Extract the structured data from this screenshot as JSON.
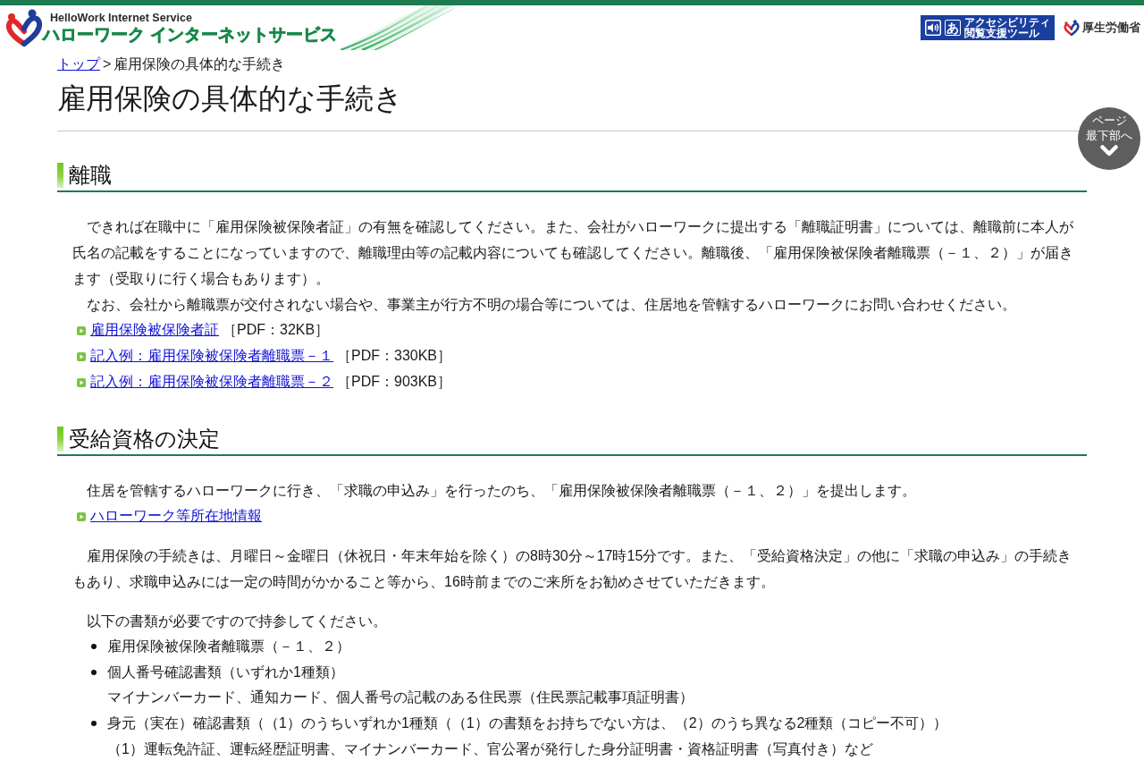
{
  "header": {
    "logo": {
      "tagline": "HelloWork Internet Service",
      "title": "ハローワーク インターネットサービス"
    },
    "accessibility_tool": {
      "glyph": "あ",
      "label_lines": [
        "アクセシビリティ",
        "閲覧支援ツール"
      ]
    },
    "ministry_logo": {
      "name": "厚生労働省"
    }
  },
  "breadcrumb": {
    "separator": ">",
    "items": [
      {
        "label": "トップ",
        "kind": "link"
      },
      {
        "label": "雇用保険の具体的な手続き",
        "kind": "current"
      }
    ]
  },
  "page_title": "雇用保険の具体的な手続き",
  "scroll_button": {
    "lines": [
      "ページ",
      "最下部へ"
    ]
  },
  "sections": [
    {
      "heading": "離職",
      "groups": [
        {
          "blocks": [
            {
              "kind": "paragraph",
              "text": "できれば在職中に「雇用保険被保険者証」の有無を確認してください。また、会社がハローワークに提出する「離職証明書」については、離職前に本人が氏名の記載をすることになっていますので、離職理由等の記載内容についても確認してください。離職後、「雇用保険被保険者離職票（－１、２）」が届きます（受取りに行く場合もあります）。"
            },
            {
              "kind": "paragraph",
              "text": "なお、会社から離職票が交付されない場合や、事業主が行方不明の場合等については、住居地を管轄するハローワークにお問い合わせください。"
            },
            {
              "kind": "links",
              "items": [
                {
                  "label": "雇用保険被保険者証",
                  "size": "［PDF：32KB］"
                },
                {
                  "label": "記入例：雇用保険被保険者離職票－１",
                  "size": "［PDF：330KB］"
                },
                {
                  "label": "記入例：雇用保険被保険者離職票－２",
                  "size": "［PDF：903KB］"
                }
              ]
            }
          ]
        }
      ]
    },
    {
      "heading": "受給資格の決定",
      "groups": [
        {
          "blocks": [
            {
              "kind": "paragraph",
              "text": "住居を管轄するハローワークに行き、「求職の申込み」を行ったのち、「雇用保険被保険者離職票（－１、２）」を提出します。"
            },
            {
              "kind": "links",
              "items": [
                {
                  "label": "ハローワーク等所在地情報"
                }
              ]
            }
          ]
        },
        {
          "blocks": [
            {
              "kind": "paragraph",
              "text": "雇用保険の手続きは、月曜日～金曜日（休祝日・年末年始を除く）の8時30分～17時15分です。また、「受給資格決定」の他に「求職の申込み」の手続きもあり、求職申込みには一定の時間がかかること等から、16時前までのご来所をお勧めさせていただきます。"
            }
          ]
        },
        {
          "blocks": [
            {
              "kind": "paragraph",
              "text": "以下の書類が必要ですので持参してください。"
            },
            {
              "kind": "bullets",
              "items": [
                {
                  "text": "雇用保険被保険者離職票（－１、２）"
                },
                {
                  "text": "個人番号確認書類（いずれか1種類）",
                  "note": "マイナンバーカード、通知カード、個人番号の記載のある住民票（住民票記載事項証明書）"
                },
                {
                  "text": "身元（実在）確認書類（（1）のうちいずれか1種類（（1）の書類をお持ちでない方は、（2）のうち異なる2種類（コピー不可））",
                  "note": "（1）運転免許証、運転経歴証明書、マイナンバーカード、官公署が発行した身分証明書・資格証明書（写真付き）など"
                }
              ]
            }
          ]
        }
      ]
    }
  ]
}
